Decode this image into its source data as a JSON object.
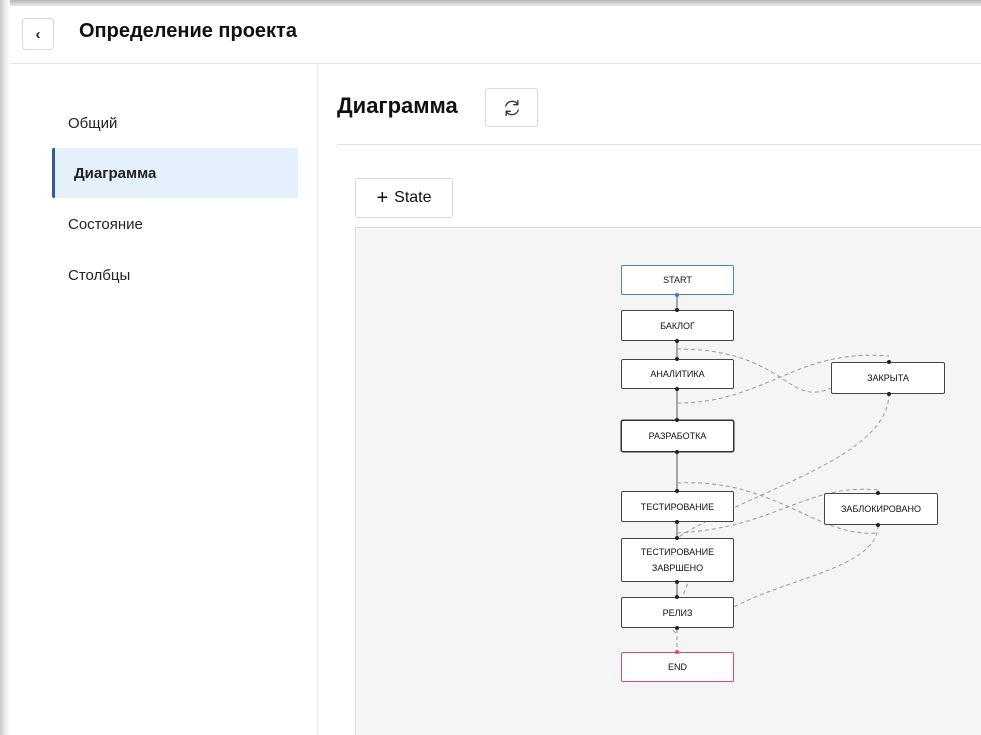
{
  "header": {
    "title": "Определение проекта",
    "back_glyph": "‹"
  },
  "sidebar": {
    "items": [
      {
        "label": "Общий",
        "active": false
      },
      {
        "label": "Диаграмма",
        "active": true
      },
      {
        "label": "Состояние",
        "active": false
      },
      {
        "label": "Столбцы",
        "active": false
      }
    ]
  },
  "main": {
    "section_title": "Диаграмма",
    "refresh_icon": "refresh-icon",
    "add_state_label": "State",
    "add_state_glyph": "+"
  },
  "diagram": {
    "nodes": {
      "start": "START",
      "backlog": "БАКЛОГ",
      "analytics": "АНАЛИТИКА",
      "closed": "ЗАКРЫТА",
      "development": "РАЗРАБОТКА",
      "testing": "ТЕСТИРОВАНИЕ",
      "blocked": "ЗАБЛОКИРОВАНО",
      "testing_done": "ТЕСТИРОВАНИЕ ЗАВРШЕНО",
      "release": "РЕЛИЗ",
      "end": "END"
    },
    "colors": {
      "start_border": "#4a7fd8",
      "end_border": "#e0457b",
      "active_nav_bg": "#e4f0fb"
    }
  }
}
